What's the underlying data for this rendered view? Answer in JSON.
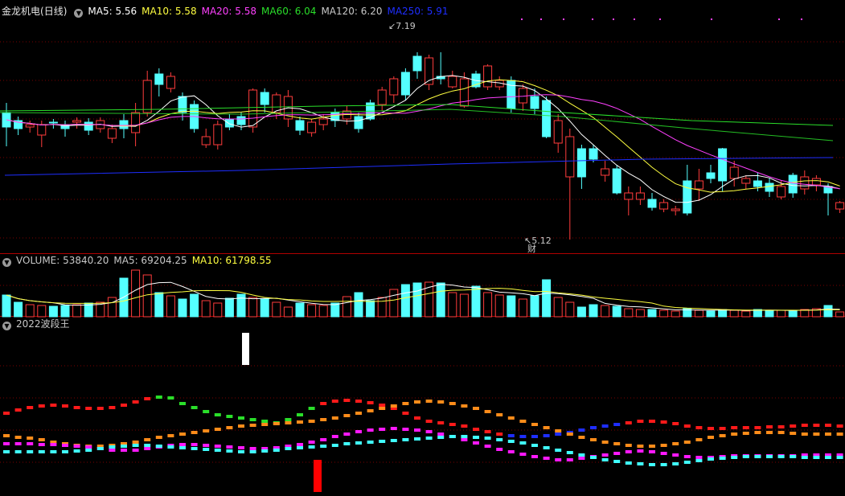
{
  "colors": {
    "up": "#ff3c3c",
    "down": "#54ffff",
    "ma5": "#ffffff",
    "ma10": "#ffff40",
    "ma20": "#ff40ff",
    "ma60": "#2adf2a",
    "ma120": "#c8c8c8",
    "ma250": "#1e2eff",
    "grid": "#7a0000",
    "separator": "#b00000"
  },
  "price_panel": {
    "stock_name": "金龙机电",
    "period": "(日线)",
    "indicators": [
      {
        "label": "MA5: 5.56",
        "color": "#ffffff"
      },
      {
        "label": "MA10: 5.58",
        "color": "#ffff40"
      },
      {
        "label": "MA20: 5.58",
        "color": "#ff40ff"
      },
      {
        "label": "MA60: 6.04",
        "color": "#2adf2a"
      },
      {
        "label": "MA120: 6.20",
        "color": "#c8c8c8"
      },
      {
        "label": "MA250: 5.91",
        "color": "#1e2eff"
      }
    ],
    "high_label": "7.19",
    "low_label": "5.12",
    "event_marker": "财"
  },
  "volume_panel": {
    "indicators": [
      {
        "label": "VOLUME: 53840.20",
        "color": "#c8c8c8"
      },
      {
        "label": "MA5: 69204.25",
        "color": "#c8c8c8"
      },
      {
        "label": "MA10: 61798.55",
        "color": "#ffff40"
      }
    ]
  },
  "wave_panel": {
    "title": "2022波段王"
  }
}
